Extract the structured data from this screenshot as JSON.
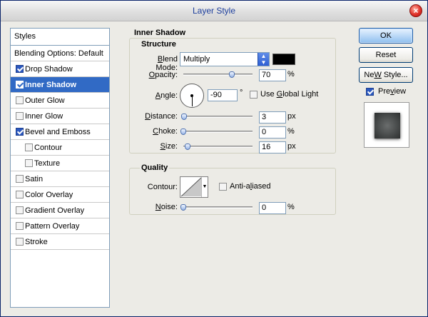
{
  "window": {
    "title": "Layer Style",
    "close_glyph": "×"
  },
  "styles_panel": {
    "header": "Styles",
    "items": [
      {
        "label": "Blending Options: Default",
        "type": "plain",
        "checked": false,
        "selected": false
      },
      {
        "label": "Drop Shadow",
        "type": "check",
        "checked": true,
        "selected": false
      },
      {
        "label": "Inner Shadow",
        "type": "check",
        "checked": true,
        "selected": true
      },
      {
        "label": "Outer Glow",
        "type": "check",
        "checked": false,
        "selected": false
      },
      {
        "label": "Inner Glow",
        "type": "check",
        "checked": false,
        "selected": false
      },
      {
        "label": "Bevel and Emboss",
        "type": "check",
        "checked": true,
        "selected": false
      },
      {
        "label": "Contour",
        "type": "sub",
        "checked": false,
        "selected": false
      },
      {
        "label": "Texture",
        "type": "sub",
        "checked": false,
        "selected": false
      },
      {
        "label": "Satin",
        "type": "check",
        "checked": false,
        "selected": false
      },
      {
        "label": "Color Overlay",
        "type": "check",
        "checked": false,
        "selected": false
      },
      {
        "label": "Gradient Overlay",
        "type": "check",
        "checked": false,
        "selected": false
      },
      {
        "label": "Pattern Overlay",
        "type": "check",
        "checked": false,
        "selected": false
      },
      {
        "label": "Stroke",
        "type": "check",
        "checked": false,
        "selected": false
      }
    ]
  },
  "inner_shadow": {
    "section_title": "Inner Shadow",
    "structure_title": "Structure",
    "blend_mode": {
      "label_access": "B",
      "label_rest": "lend Mode:",
      "value": "Multiply",
      "color": "#000000"
    },
    "opacity": {
      "label_access": "O",
      "label_rest": "pacity:",
      "value": "70",
      "unit": "%",
      "fraction": 0.7
    },
    "angle": {
      "label_access": "A",
      "label_rest": "ngle:",
      "value": "-90",
      "unit": "°",
      "degrees": -90,
      "global_light_pre": "Use ",
      "global_light_access": "G",
      "global_light_rest": "lobal Light",
      "global_light_checked": false
    },
    "distance": {
      "label_access": "D",
      "label_rest": "istance:",
      "value": "3",
      "unit": "px",
      "fraction": 0.01
    },
    "choke": {
      "label_access": "C",
      "label_rest": "hoke:",
      "value": "0",
      "unit": "%",
      "fraction": 0.0
    },
    "size": {
      "label_access": "S",
      "label_rest": "ize:",
      "value": "16",
      "unit": "px",
      "fraction": 0.06
    }
  },
  "quality": {
    "title": "Quality",
    "contour_label": "Contour:",
    "anti_aliased_pre": "Anti-a",
    "anti_aliased_access": "l",
    "anti_aliased_rest": "iased",
    "anti_aliased_checked": false,
    "noise": {
      "label_access": "N",
      "label_rest": "oise:",
      "value": "0",
      "unit": "%",
      "fraction": 0.0
    }
  },
  "buttons": {
    "ok": "OK",
    "reset": "Reset",
    "new_style_access": "W",
    "new_style_pre": "Ne",
    "new_style_rest": " Style...",
    "preview_pre": "Pre",
    "preview_access": "v",
    "preview_rest": "iew",
    "preview_checked": true
  }
}
